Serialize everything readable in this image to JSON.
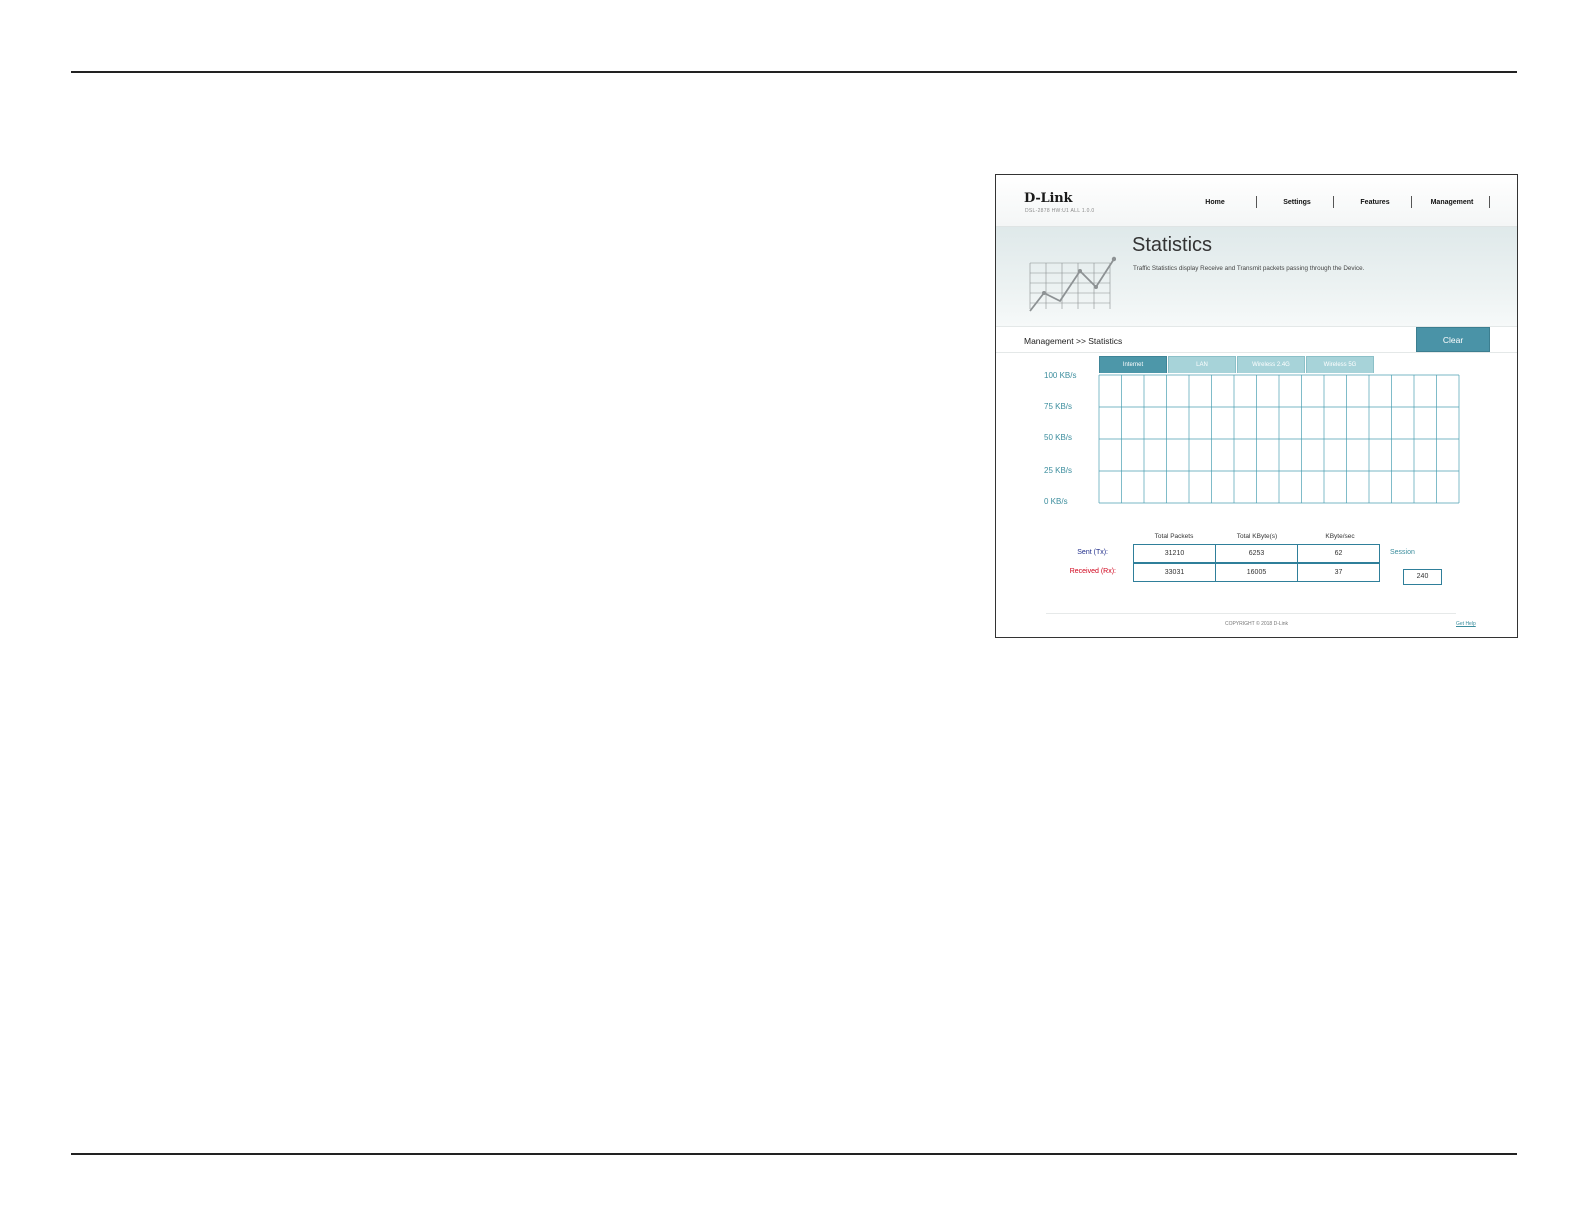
{
  "brand": {
    "logo": "D-Link",
    "model": "DSL-2878 HW:U1 ALL 1.0.0"
  },
  "nav": [
    {
      "label": "Home"
    },
    {
      "label": "Settings"
    },
    {
      "label": "Features"
    },
    {
      "label": "Management"
    }
  ],
  "banner": {
    "title": "Statistics",
    "description": "Traffic Statistics display Receive and Transmit packets passing through the Device."
  },
  "breadcrumb": "Management >> Statistics",
  "clear_label": "Clear",
  "tabs": [
    {
      "label": "Internet",
      "active": true
    },
    {
      "label": "LAN",
      "active": false
    },
    {
      "label": "Wireless 2.4G",
      "active": false
    },
    {
      "label": "Wireless 5G",
      "active": false
    }
  ],
  "graph": {
    "y_labels": [
      "100 KB/s",
      "75 KB/s",
      "50 KB/s",
      "25 KB/s",
      "0 KB/s"
    ]
  },
  "stats": {
    "columns": [
      "Total Packets",
      "Total KByte(s)",
      "KByte/sec"
    ],
    "sent_label": "Sent (Tx):",
    "received_label": "Received (Rx):",
    "sent": [
      "31210",
      "6253",
      "62"
    ],
    "received": [
      "33031",
      "16005",
      "37"
    ],
    "session_label": "Session",
    "session_value": "240"
  },
  "footer": {
    "copyright": "COPYRIGHT © 2018 D-Link",
    "help": "Get Help"
  },
  "colors": {
    "accent": "#4a93a7",
    "sent": "#1f2d8a",
    "received": "#d0021b"
  }
}
